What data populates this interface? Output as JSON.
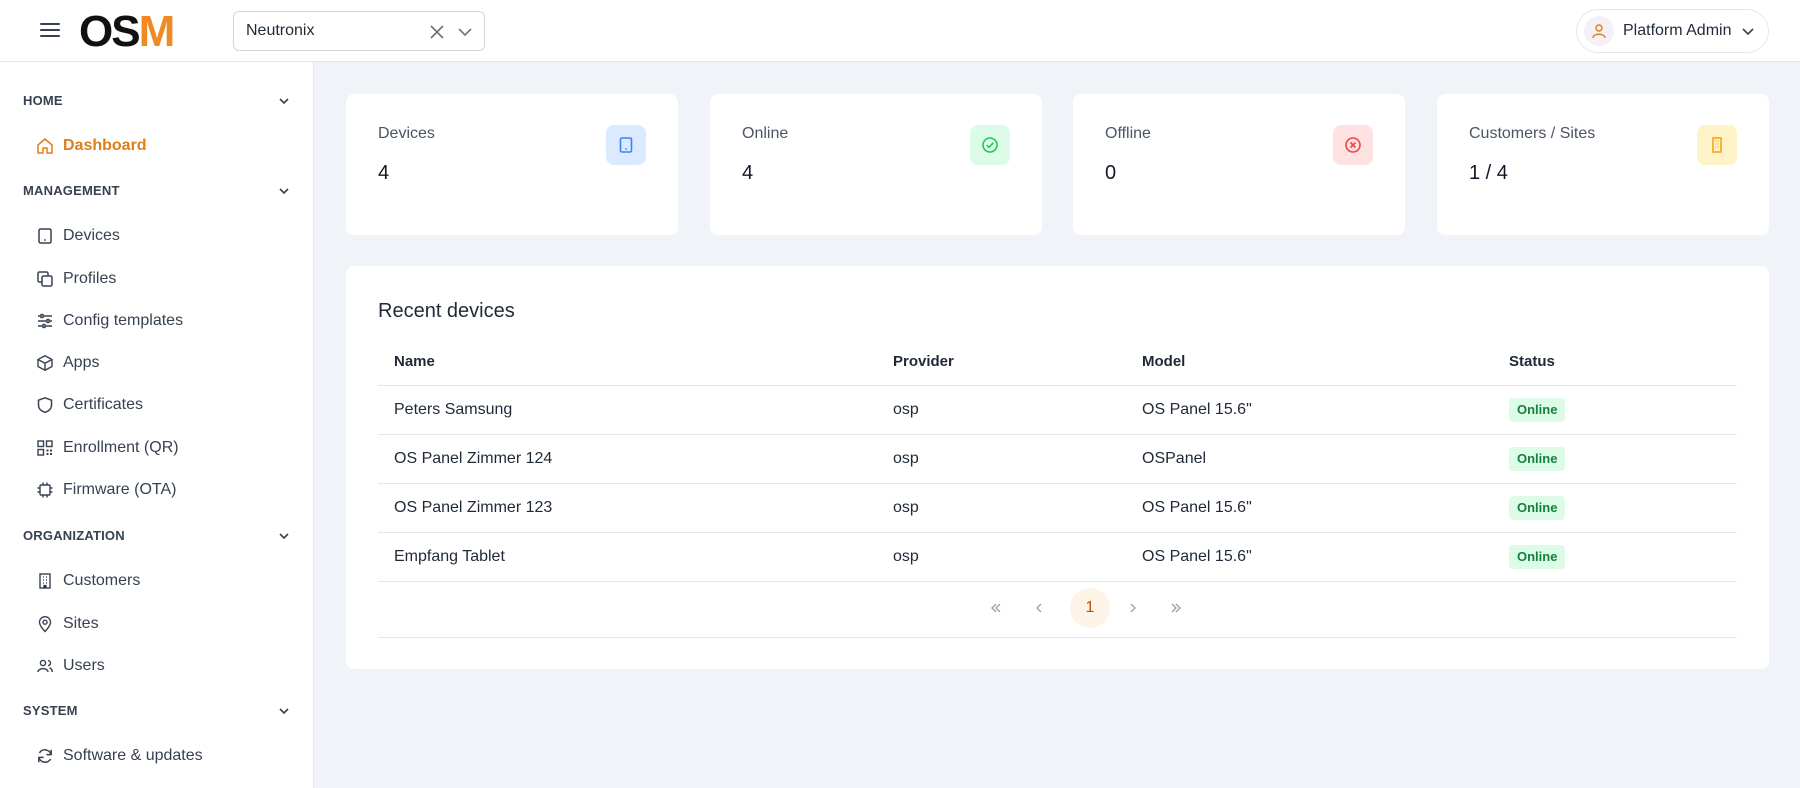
{
  "header": {
    "logo_text": "OSM",
    "tenant": {
      "value": "Neutronix"
    },
    "user": {
      "name": "Platform Admin"
    }
  },
  "sidebar": {
    "sections": [
      {
        "label": "HOME",
        "items": [
          {
            "label": "Dashboard",
            "icon": "home-icon",
            "active": true
          }
        ]
      },
      {
        "label": "MANAGEMENT",
        "items": [
          {
            "label": "Devices",
            "icon": "tablet-icon"
          },
          {
            "label": "Profiles",
            "icon": "copy-icon"
          },
          {
            "label": "Config templates",
            "icon": "sliders-icon"
          },
          {
            "label": "Apps",
            "icon": "package-icon"
          },
          {
            "label": "Certificates",
            "icon": "shield-icon"
          },
          {
            "label": "Enrollment (QR)",
            "icon": "qr-code-icon"
          },
          {
            "label": "Firmware (OTA)",
            "icon": "cpu-icon"
          }
        ]
      },
      {
        "label": "ORGANIZATION",
        "items": [
          {
            "label": "Customers",
            "icon": "building-icon"
          },
          {
            "label": "Sites",
            "icon": "map-pin-icon"
          },
          {
            "label": "Users",
            "icon": "users-icon"
          }
        ]
      },
      {
        "label": "SYSTEM",
        "items": [
          {
            "label": "Software & updates",
            "icon": "refresh-icon"
          }
        ]
      }
    ]
  },
  "stats": [
    {
      "label": "Devices",
      "value": "4",
      "icon": "tablet-icon",
      "color": "#3b82f6",
      "bg": "#dbeafe"
    },
    {
      "label": "Online",
      "value": "4",
      "icon": "check-circle-icon",
      "color": "#22c55e",
      "bg": "#dcfce7"
    },
    {
      "label": "Offline",
      "value": "0",
      "icon": "x-circle-icon",
      "color": "#ef4444",
      "bg": "#fee2e2"
    },
    {
      "label": "Customers / Sites",
      "value": "1 / 4",
      "icon": "building-icon",
      "color": "#f59e0b",
      "bg": "#fef3c7"
    }
  ],
  "recent": {
    "title": "Recent devices",
    "columns": [
      "Name",
      "Provider",
      "Model",
      "Status"
    ],
    "rows": [
      {
        "name": "Peters Samsung",
        "provider": "osp",
        "model": "OS Panel 15.6\"",
        "status": "Online"
      },
      {
        "name": "OS Panel Zimmer 124",
        "provider": "osp",
        "model": "OSPanel",
        "status": "Online"
      },
      {
        "name": "OS Panel Zimmer 123",
        "provider": "osp",
        "model": "OS Panel 15.6\"",
        "status": "Online"
      },
      {
        "name": "Empfang Tablet",
        "provider": "osp",
        "model": "OS Panel 15.6\"",
        "status": "Online"
      }
    ],
    "pagination": {
      "current_page": "1"
    }
  },
  "colors": {
    "accent": "#e07d17",
    "online": "#15803d",
    "online_bg": "#dcfce7"
  }
}
